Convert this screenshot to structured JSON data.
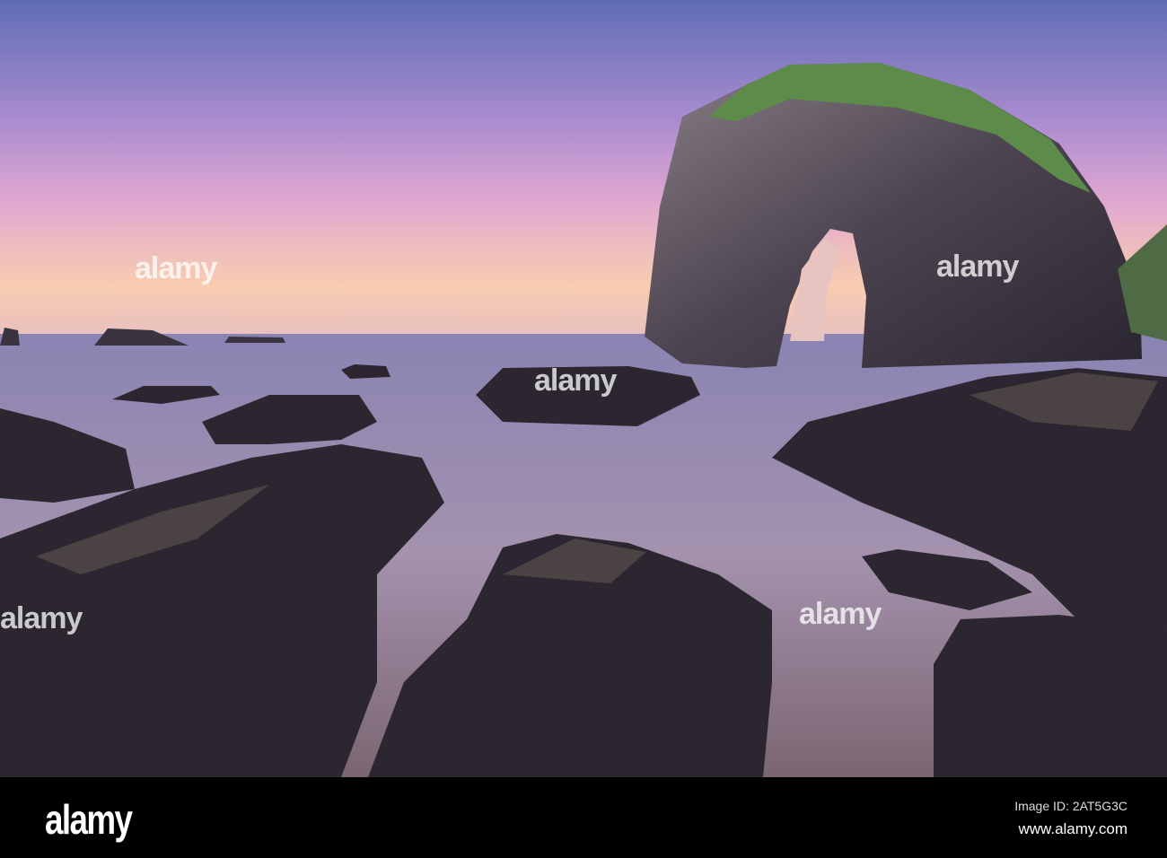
{
  "watermark": {
    "logo": "alamy",
    "overlay_text": "alamy"
  },
  "footer": {
    "image_id": "Image ID: 2AT5G3C",
    "site": "www.alamy.com"
  },
  "colors": {
    "sky_top": "#6a6fb8",
    "sky_horizon": "#f6c7b0",
    "sea": "#9d8fae",
    "rock": "#2e2a33",
    "moss": "#5d8b4a"
  }
}
